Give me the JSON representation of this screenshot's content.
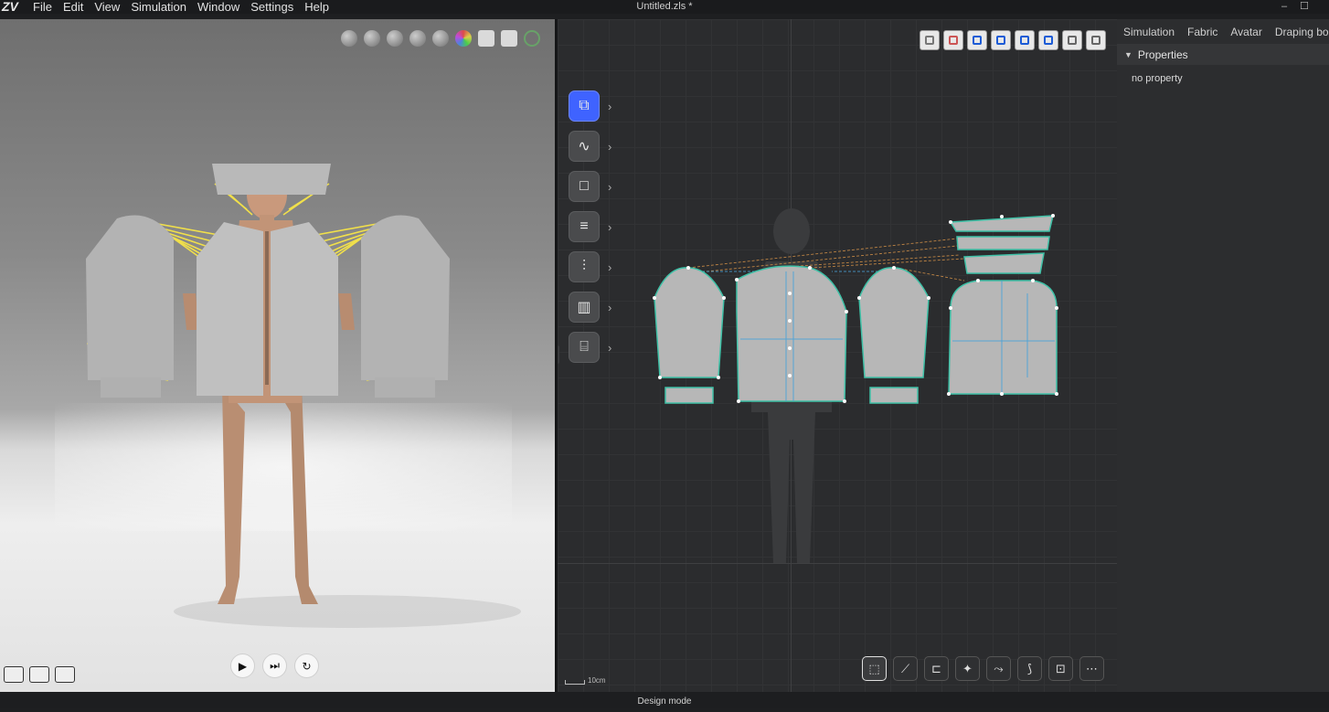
{
  "app": {
    "logo": "ZV",
    "document_title": "Untitled.zls *"
  },
  "menu": [
    "File",
    "Edit",
    "View",
    "Simulation",
    "Window",
    "Settings",
    "Help"
  ],
  "window_controls": {
    "minimize": "–",
    "maximize": "☐"
  },
  "viewport3d": {
    "toolbar_icons": [
      "avatar-display-icon",
      "texture-display-icon",
      "layer-display-icon",
      "pose-display-icon",
      "avatar-icon",
      "color-icon",
      "copy-icon",
      "undo-icon",
      "axis-icon"
    ],
    "playback": {
      "play": "▶",
      "step": "⏭",
      "reset": "↻"
    },
    "capture_icons": [
      "image-icon",
      "zoom-image-icon",
      "camera-icon"
    ]
  },
  "viewport2d": {
    "top_toolbar_icons": [
      "display-3d-icon",
      "grid-icon",
      "show-arrangement-icon",
      "show-seam-icon",
      "show-notch-icon",
      "show-baseline-icon",
      "texture-icon",
      "view-options-icon"
    ],
    "left_tools": [
      {
        "name": "transform-pattern-icon",
        "glyph": "⧉",
        "active": true
      },
      {
        "name": "curve-tool-icon",
        "glyph": "∿",
        "active": false
      },
      {
        "name": "rectangle-tool-icon",
        "glyph": "□",
        "active": false
      },
      {
        "name": "sewing-tool-icon",
        "glyph": "≡",
        "active": false
      },
      {
        "name": "zipper-tool-icon",
        "glyph": "⫶",
        "active": false
      },
      {
        "name": "fabric-map-icon",
        "glyph": "▥",
        "active": false
      },
      {
        "name": "measure-tape-icon",
        "glyph": "⌸",
        "active": false
      }
    ],
    "bottom_tools": [
      "⬚",
      "⟋",
      "⊏",
      "✦",
      "⤳",
      "⟆",
      "⊡",
      "⋯"
    ],
    "scale_label": "10cm"
  },
  "sidepanel": {
    "tabs": [
      "Simulation",
      "Fabric",
      "Avatar",
      "Draping bo"
    ],
    "section_title": "Properties",
    "empty_text": "no property"
  },
  "status": {
    "mode": "Design mode"
  }
}
